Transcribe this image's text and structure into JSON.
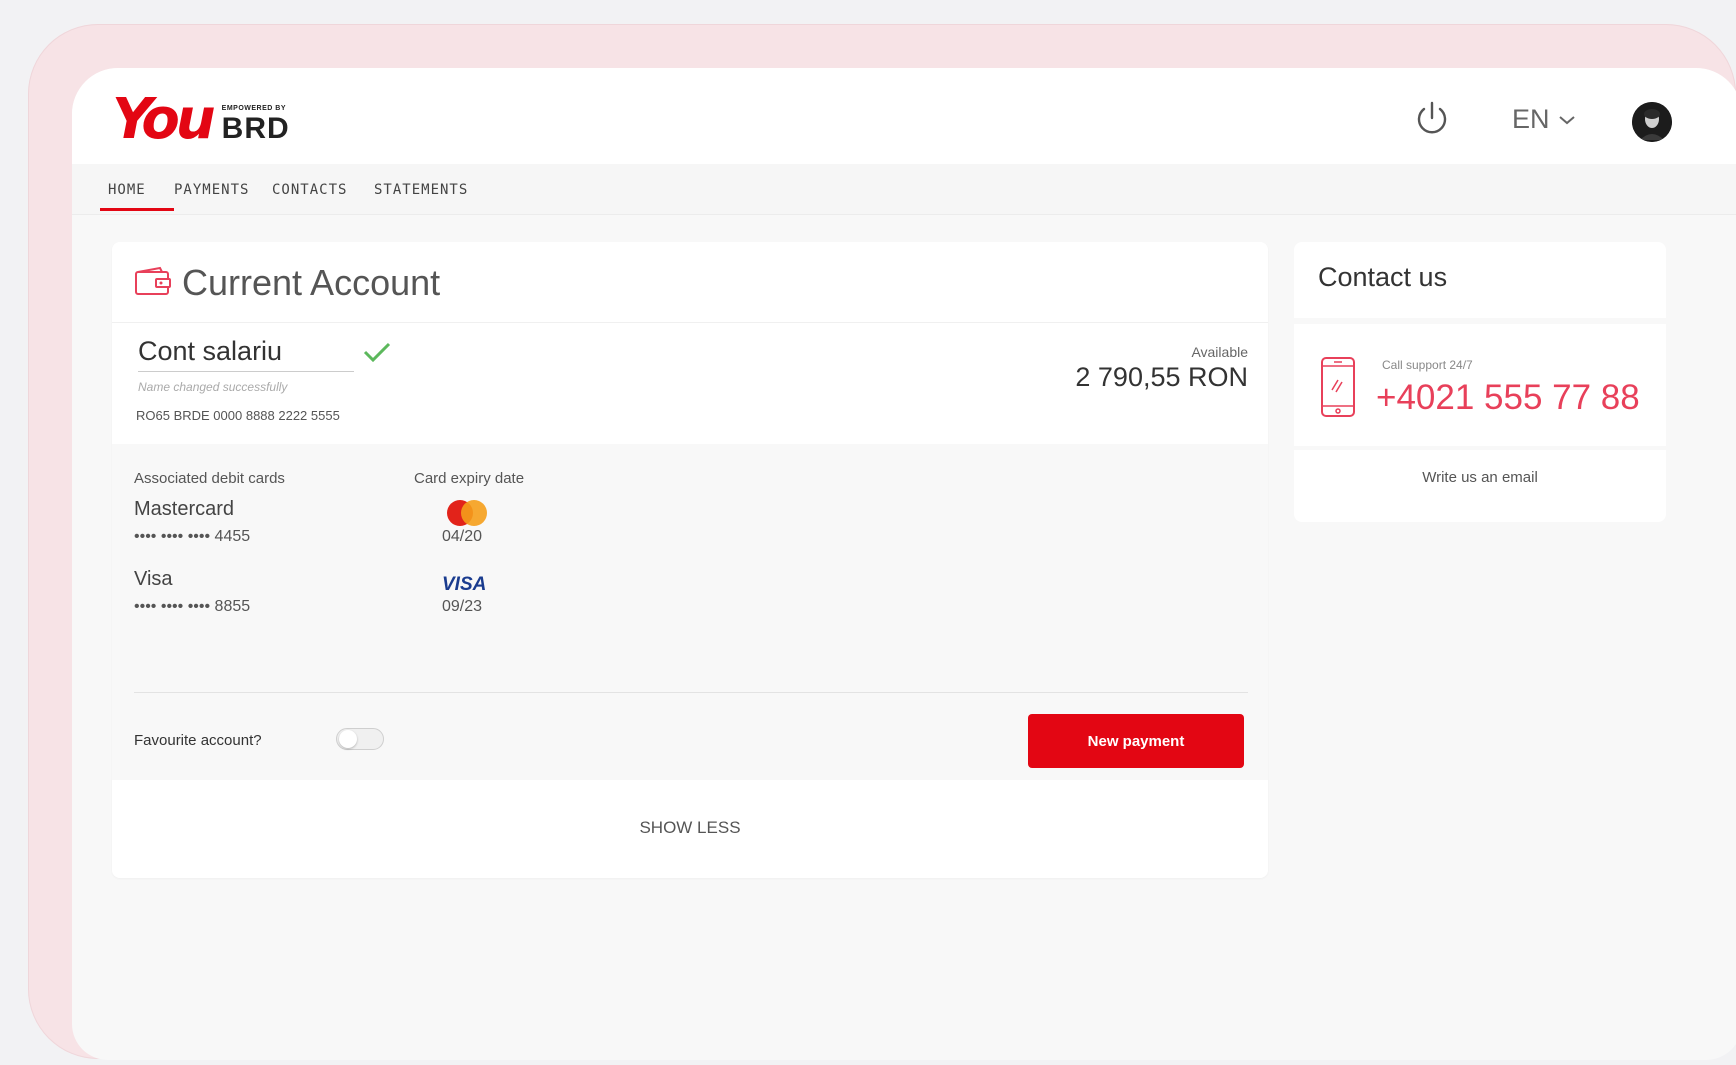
{
  "header": {
    "logo_you": "You",
    "logo_powered": "EMPOWERED BY",
    "logo_brd": "BRD",
    "language": "EN"
  },
  "nav": {
    "items": [
      "HOME",
      "PAYMENTS",
      "CONTACTS",
      "STATEMENTS"
    ],
    "active": "HOME"
  },
  "account": {
    "title": "Current Account",
    "name": "Cont salariu",
    "name_message": "Name changed successfully",
    "iban": "RO65 BRDE 0000 8888 2222 5555",
    "available_label": "Available",
    "available_amount": "2 790,55 RON"
  },
  "cards": {
    "col_cards_label": "Associated debit cards",
    "col_expiry_label": "Card expiry date",
    "items": [
      {
        "name": "Mastercard",
        "number": "•••• •••• •••• 4455",
        "expiry": "04/20",
        "brand_icon": "mastercard-icon"
      },
      {
        "name": "Visa",
        "number": "•••• •••• •••• 8855",
        "expiry": "09/23",
        "brand_icon": "visa-icon",
        "brand_text": "VISA"
      }
    ]
  },
  "favourite": {
    "label": "Favourite account?",
    "enabled": false
  },
  "actions": {
    "new_payment": "New payment",
    "show_less": "SHOW LESS"
  },
  "contact": {
    "title": "Contact us",
    "call_label": "Call support 24/7",
    "phone": "+4021 555 77 88",
    "email_link": "Write us an email"
  },
  "colors": {
    "brand_red": "#e30613",
    "phone_pink": "#e8405a",
    "check_green": "#5cb85c",
    "visa_blue": "#1a3c8f"
  }
}
